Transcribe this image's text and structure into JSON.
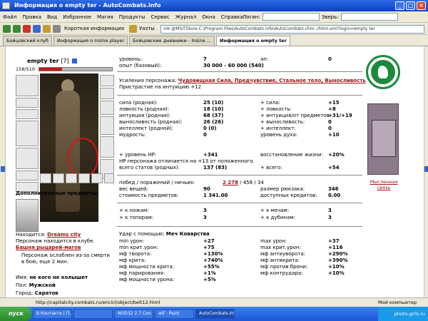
{
  "window": {
    "title": "Информация о empty ter - AutoCombats.info"
  },
  "menu": [
    "Файл",
    "Правка",
    "Вид",
    "Избранное",
    "Магия",
    "Продукты",
    "Сервис",
    "Журнал",
    "Окна",
    "Справка"
  ],
  "search": {
    "login_label": "Логин:",
    "zver_label": "Зверь:"
  },
  "toolbar": {
    "short_info": "Короткая информация",
    "bookmarks": "Уазты",
    "address": "mk:@MSITStore:C:\\Program Files\\AutoCombats.info\\AutoCombats.chm::/html.xml?login=empty ter"
  },
  "tabs": [
    "Бойцовский клуб",
    "Информация о Insine player",
    "Бойцовские дневники - Insine ...",
    "Информация о empty ter"
  ],
  "character": {
    "name": "empty ter",
    "level": "[7]",
    "hp": "158/510",
    "hp_fraction": 0.31
  },
  "info": {
    "additional_items": "Дополнительные предметы:",
    "location_label": "Находится:",
    "location": "Dreams city",
    "in_club": "Персонаж находится в клубе.",
    "tower": "Башня рыцарей-магов",
    "weakened": "Персонаж ослаблен из-за смерти в бою, еще 2 мин.",
    "owner_label": "Имя:",
    "owner": "не кого не колышет",
    "gender_label": "Пол:",
    "gender": "Мужской",
    "city_label": "Город:",
    "city": "Саратов"
  },
  "stats": {
    "level_label": "уровень:",
    "level_val": "7",
    "ap_label": "ап:",
    "ap_val": "0",
    "exp_label": "опыт (базовый):",
    "exp_val": "30 000 - 60 000 (540)",
    "boost_label": "Усиления персонажа:",
    "boosts": "Чудовищная Сила, Предчувствие, Стальное тело, Выносливость",
    "intuition_boost": "Пристрастие на интуицию +12",
    "left": [
      [
        "сила (родная):",
        "25 (10)"
      ],
      [
        "ловкость (родная):",
        "18 (10)"
      ],
      [
        "интуиция (родная):",
        "68 (37)"
      ],
      [
        "выносливость (родная):",
        "26 (26)"
      ],
      [
        "интеллект (родной):",
        "0 (0)"
      ],
      [
        "мудрость:",
        "0"
      ]
    ],
    "right": [
      [
        "+ сила:",
        "+15"
      ],
      [
        "+ ловкость:",
        "+8"
      ],
      [
        "+ интуиция/от предметов:",
        "+31/+19"
      ],
      [
        "+ выносливость:",
        "0"
      ],
      [
        "+ интеллект:",
        "0"
      ],
      [
        "уровень духа:",
        "+10"
      ]
    ],
    "hp_level_label": "+ уровень HP:",
    "hp_level_val": "+341",
    "regen_label": "восстановление жизни:",
    "regen_val": "+20%",
    "hp_note": "HP персонажа отличается на +13 от положенного.",
    "total_label": "всего статов (родных):",
    "total_val": "137 (83)",
    "total_plus_label": "+ всего:",
    "total_plus_val": "+54",
    "wins_label": "побед / поражений / ничьих:",
    "wins_val": "2 278",
    "wins_rest": " / 458 / 34",
    "weight_label": "вес вещей:",
    "weight_val": "90",
    "backpack_label": "размер рюкзака:",
    "backpack_val": "346",
    "cost_label": "стоимость предметов:",
    "cost_val": "1 341.00",
    "credits_label": "доступных кредитов:",
    "credits_val": "0.00",
    "skills": [
      [
        "+ к ножам:",
        "3",
        "+ к мечам:",
        "3"
      ],
      [
        "+ к топорам:",
        "3",
        "+ к дубинам:",
        "3"
      ]
    ],
    "hit_label": "Удар с помощью:",
    "hit_val": "Меч Коварства",
    "combat": [
      [
        "min урон:",
        "+27",
        "max урон:",
        "+37"
      ],
      [
        "min крит.урон:",
        "+75",
        "max крит.урон:",
        "+116"
      ],
      [
        "мф творота:",
        "+130%",
        "мф антиуворота:",
        "+290%"
      ],
      [
        "мф крита:",
        "+740%",
        "мф антикрита:",
        "+390%"
      ],
      [
        "мф мощности крита:",
        "+55%",
        "мф против брони:",
        "+10%"
      ],
      [
        "мф парирования:",
        "+1%",
        "мф контрудара:",
        "+10%"
      ],
      [
        "мф мощности урона:",
        "+5%",
        "",
        ""
      ]
    ]
  },
  "banner": {
    "caption": "Мысленная связь"
  },
  "status": {
    "url": "http://capitalcity.combats.ru/encicl/object/belt12.html",
    "zone": "Мой компьютер"
  },
  "taskbar": {
    "start": "пуск",
    "tasks": [
      "В Контакте | П...",
      "",
      "NOD32 2.7 Con...",
      "wif - Paint",
      "AutoCombats.info"
    ],
    "tray": "photo.girls.ru"
  }
}
